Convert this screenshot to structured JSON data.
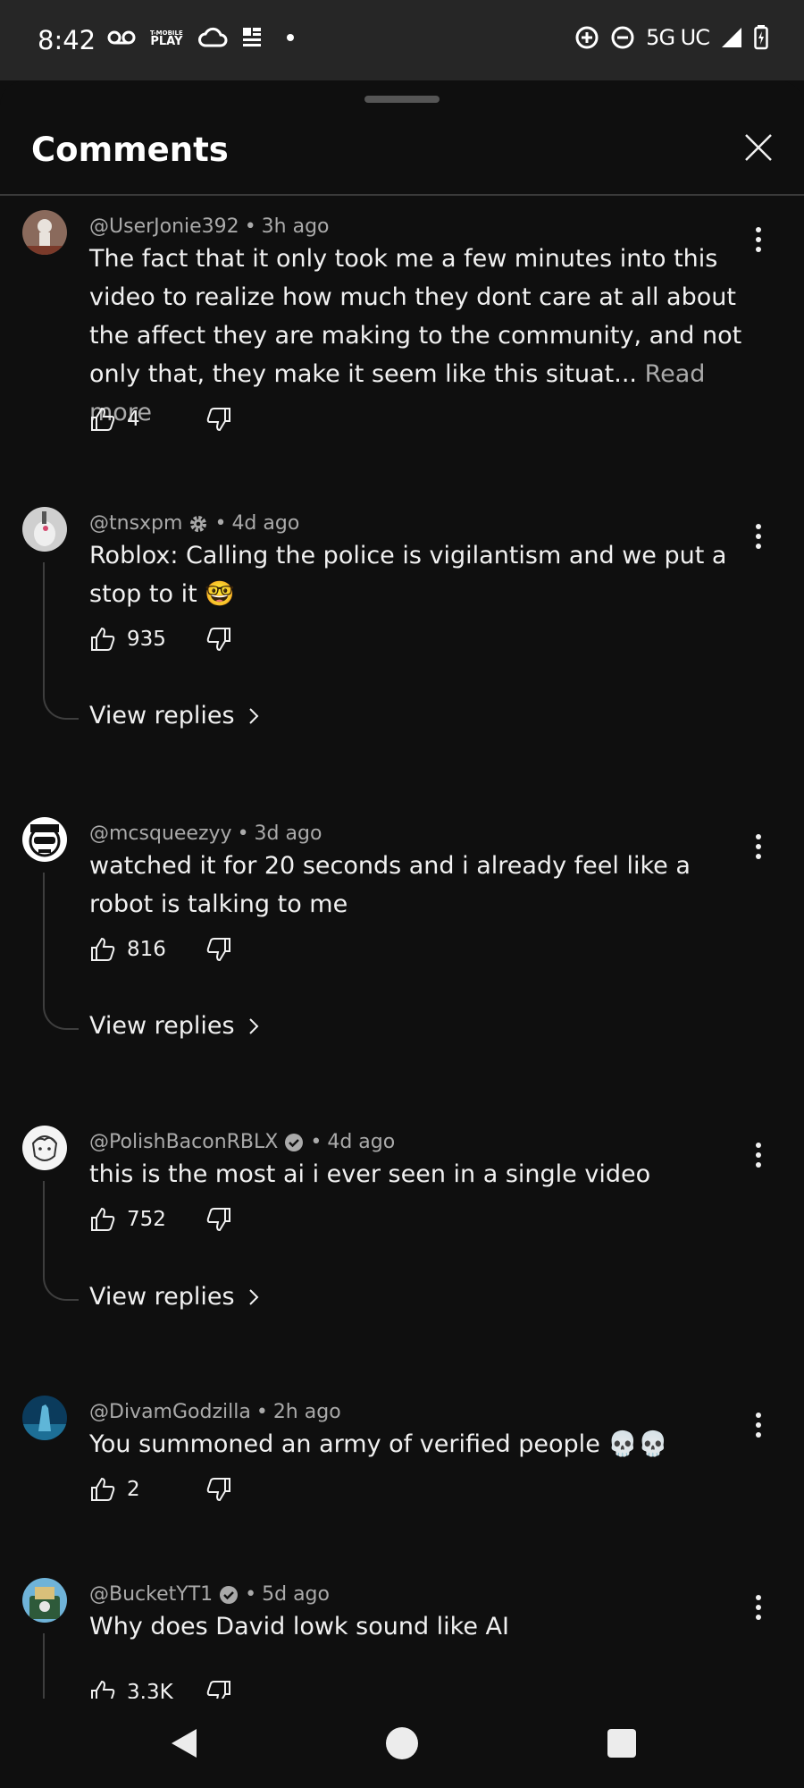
{
  "status_bar": {
    "time": "8:42",
    "left_icons": [
      "voicemail-icon",
      "t-mobile-play-icon",
      "cloud-icon",
      "news-icon",
      "dot-icon"
    ],
    "tmobile_small": "T-MOBILE",
    "tmobile_play": "PLAY",
    "network": "5G UC",
    "right_icons": [
      "data-saver-icon",
      "do-not-disturb-icon",
      "signal-icon",
      "battery-icon"
    ]
  },
  "sheet": {
    "title": "Comments",
    "close_icon": "close-icon"
  },
  "comments": [
    {
      "handle": "@UserJonie392",
      "time": "3h ago",
      "verified": false,
      "text": "The fact that it only took me a few minutes into this video to realize how much they dont care at all about the affect they are making to the community, and not only that, they make it seem like this situat...",
      "read_more": "Read more",
      "likes": "4",
      "view_replies": ""
    },
    {
      "handle": "@tnsxpm",
      "time": "4d ago",
      "verified": false,
      "gear_badge": true,
      "text": "Roblox: Calling the police is vigilantism and we put a stop to it 🤓",
      "likes": "935",
      "view_replies": "View replies"
    },
    {
      "handle": "@mcsqueezyy",
      "time": "3d ago",
      "verified": false,
      "text": "watched it for 20 seconds and i already feel like a robot is talking to me",
      "likes": "816",
      "view_replies": "View replies"
    },
    {
      "handle": "@PolishBaconRBLX",
      "time": "4d ago",
      "verified": true,
      "text": "this is the most ai i ever seen in a single video",
      "likes": "752",
      "view_replies": "View replies"
    },
    {
      "handle": "@DivamGodzilla",
      "time": "2h ago",
      "verified": false,
      "text": "You summoned an army of verified people 💀💀",
      "likes": "2",
      "view_replies": ""
    },
    {
      "handle": "@BucketYT1",
      "time": "5d ago",
      "verified": true,
      "text": "Why does David lowk sound like AI",
      "likes": "3.3K",
      "view_replies": ""
    }
  ],
  "separator": "•",
  "nav_bar": {
    "icons": [
      "back-icon",
      "home-icon",
      "recents-icon"
    ]
  },
  "colors": {
    "background": "#0f0f0f",
    "status_bar": "#262626",
    "text_primary": "#f1f1f1",
    "text_secondary": "#aaaaaa",
    "divider": "#3a3a3a"
  }
}
